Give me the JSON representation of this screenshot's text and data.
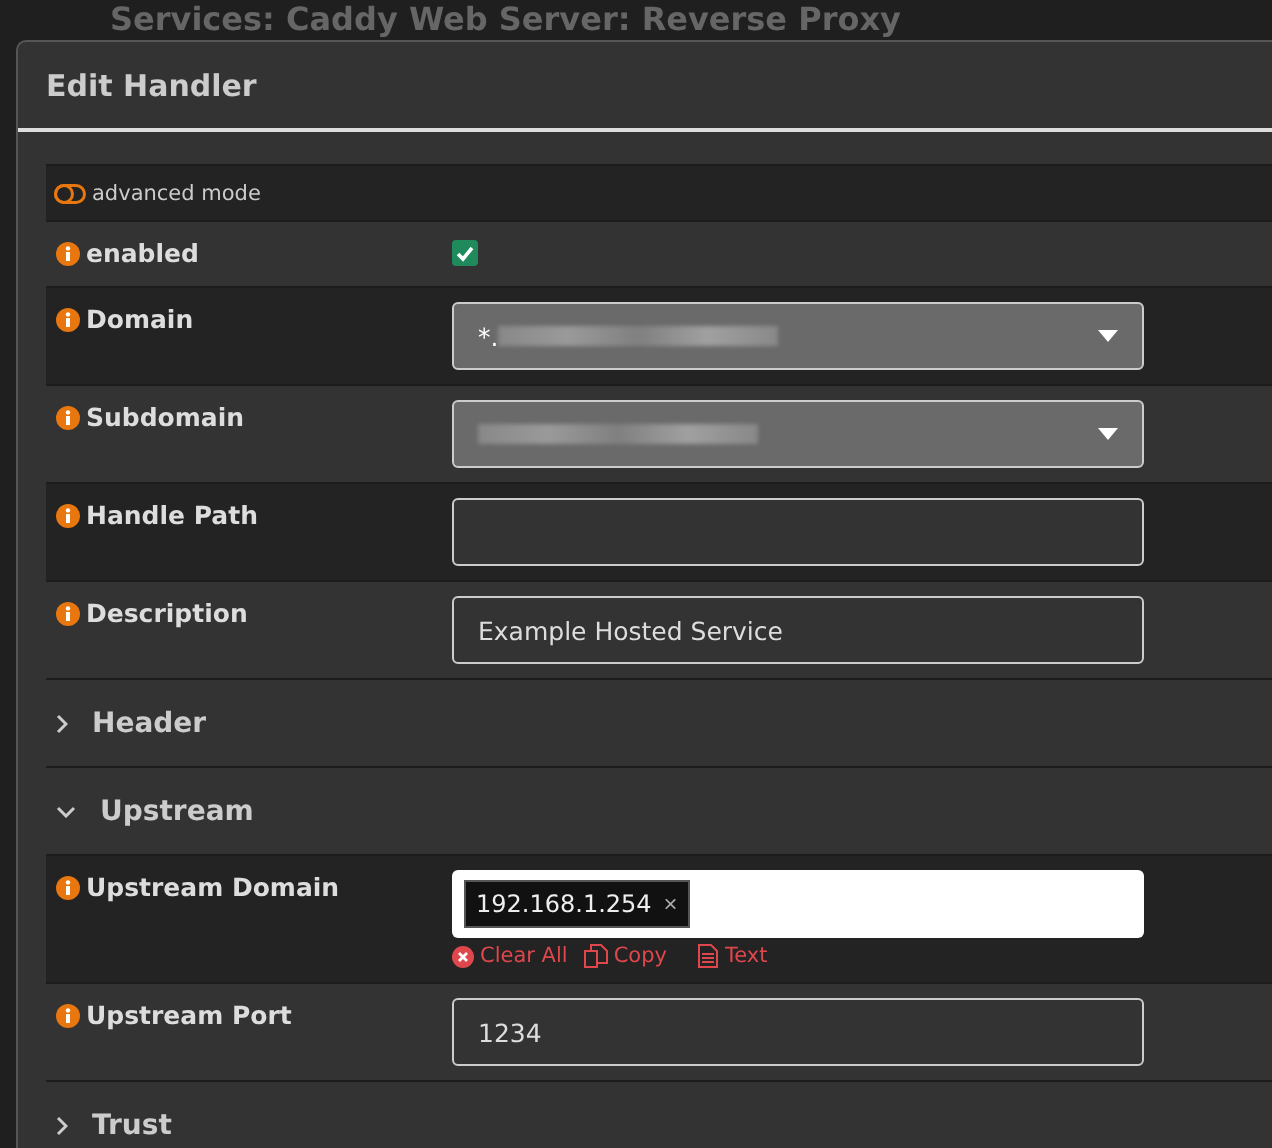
{
  "background_title": "Services: Caddy Web Server: Reverse Proxy",
  "dialog": {
    "title": "Edit Handler",
    "advanced_mode": {
      "label": "advanced mode",
      "on": false
    },
    "fields": [
      {
        "kind": "checkbox",
        "label": "enabled",
        "checked": true
      },
      {
        "kind": "select",
        "label": "Domain",
        "value": "*.",
        "redacted": true
      },
      {
        "kind": "select",
        "label": "Subdomain",
        "redacted": true
      },
      {
        "kind": "text",
        "label": "Handle Path"
      },
      {
        "kind": "text",
        "label": "Description",
        "value": "Example Hosted Service"
      }
    ],
    "sections": [
      {
        "title": "Header",
        "expanded": false
      },
      {
        "title": "Upstream",
        "expanded": true,
        "fields": [
          {
            "kind": "tags",
            "label": "Upstream Domain",
            "tags": [
              "192.168.1.254"
            ],
            "tag_remove": "×",
            "actions": [
              {
                "kind": "clear",
                "label": "Clear All"
              },
              {
                "kind": "copy",
                "label": "Copy"
              },
              {
                "kind": "text",
                "label": "Text"
              }
            ]
          },
          {
            "kind": "text",
            "label": "Upstream Port",
            "value": "1234"
          }
        ]
      },
      {
        "title": "Trust",
        "expanded": false
      }
    ]
  }
}
